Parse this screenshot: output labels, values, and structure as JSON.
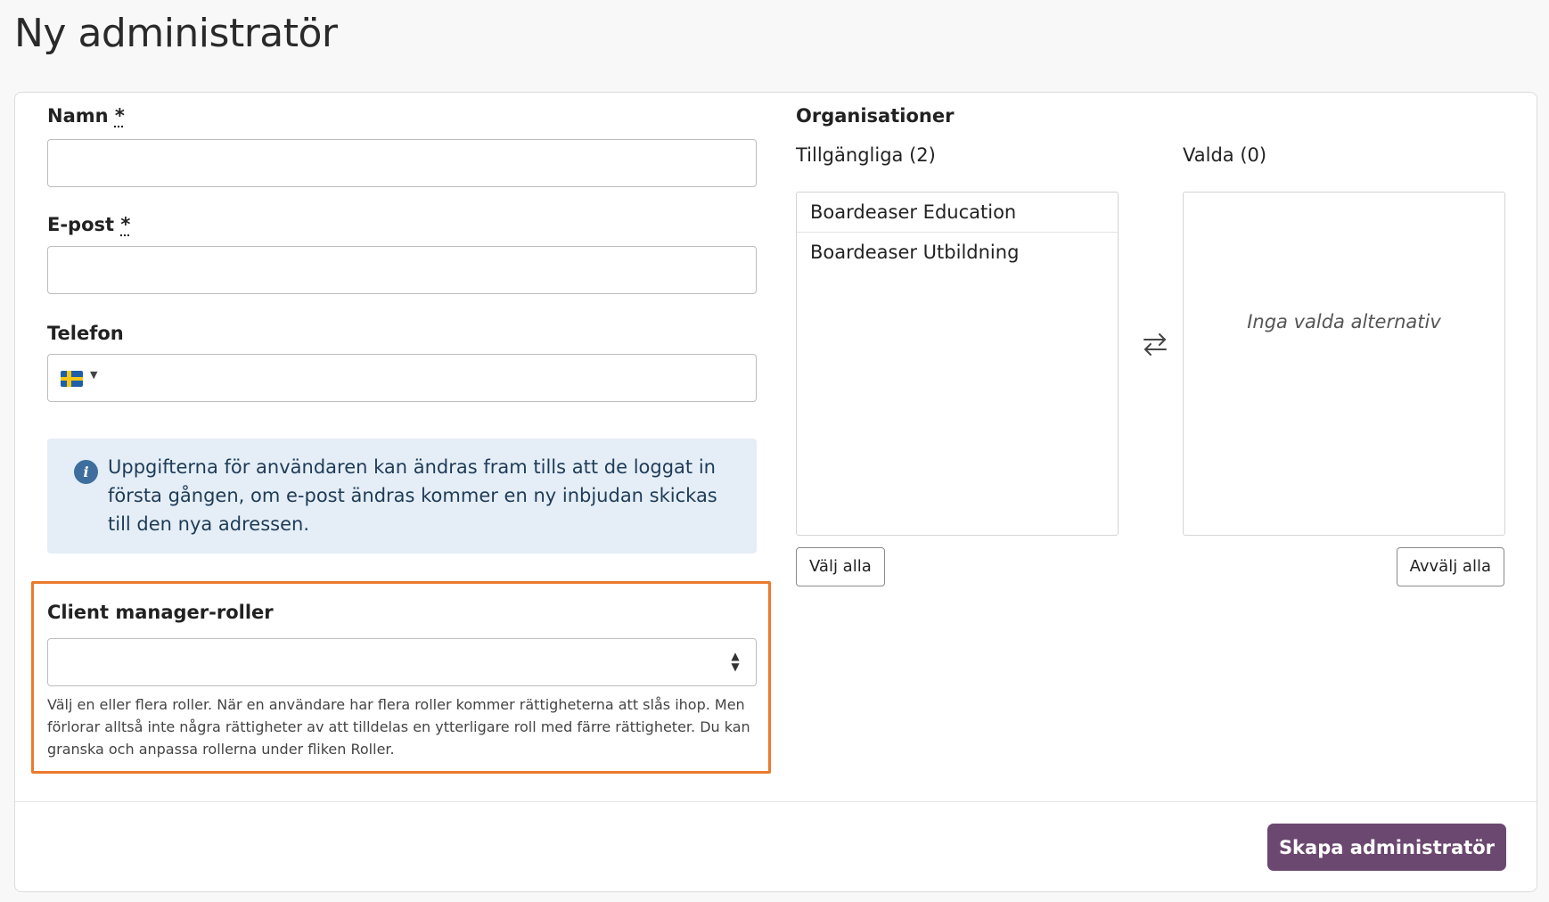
{
  "page": {
    "title": "Ny administratör"
  },
  "form": {
    "name": {
      "label": "Namn",
      "required_mark": "*",
      "value": ""
    },
    "email": {
      "label": "E-post",
      "required_mark": "*",
      "value": ""
    },
    "phone": {
      "label": "Telefon",
      "value": "",
      "country_flag": "Sweden"
    },
    "info_text": "Uppgifterna för användaren kan ändras fram tills att de loggat in första gången, om e-post ändras kommer en ny inbjudan skickas till den nya adressen.",
    "roles": {
      "label": "Client manager-roller",
      "value": "",
      "help": "Välj en eller flera roller. När en användare har flera roller kommer rättigheterna att slås ihop. Men förlorar alltså inte några rättigheter av att tilldelas en ytterligare roll med färre rättigheter. Du kan granska och anpassa rollerna under fliken Roller."
    }
  },
  "organizations": {
    "label": "Organisationer",
    "available": {
      "label": "Tillgängliga (2)",
      "items": [
        "Boardeaser Education",
        "Boardeaser Utbildning"
      ],
      "select_all_label": "Välj alla"
    },
    "selected": {
      "label": "Valda (0)",
      "empty_text": "Inga valda alternativ",
      "deselect_all_label": "Avvälj alla"
    },
    "swap_icon": "swap-arrows-icon"
  },
  "actions": {
    "submit_label": "Skapa administratör"
  },
  "colors": {
    "primary_button": "#6b4870",
    "highlight_border": "#ea7a2c",
    "info_background": "#e5eef6",
    "info_icon": "#3d6e9e"
  }
}
